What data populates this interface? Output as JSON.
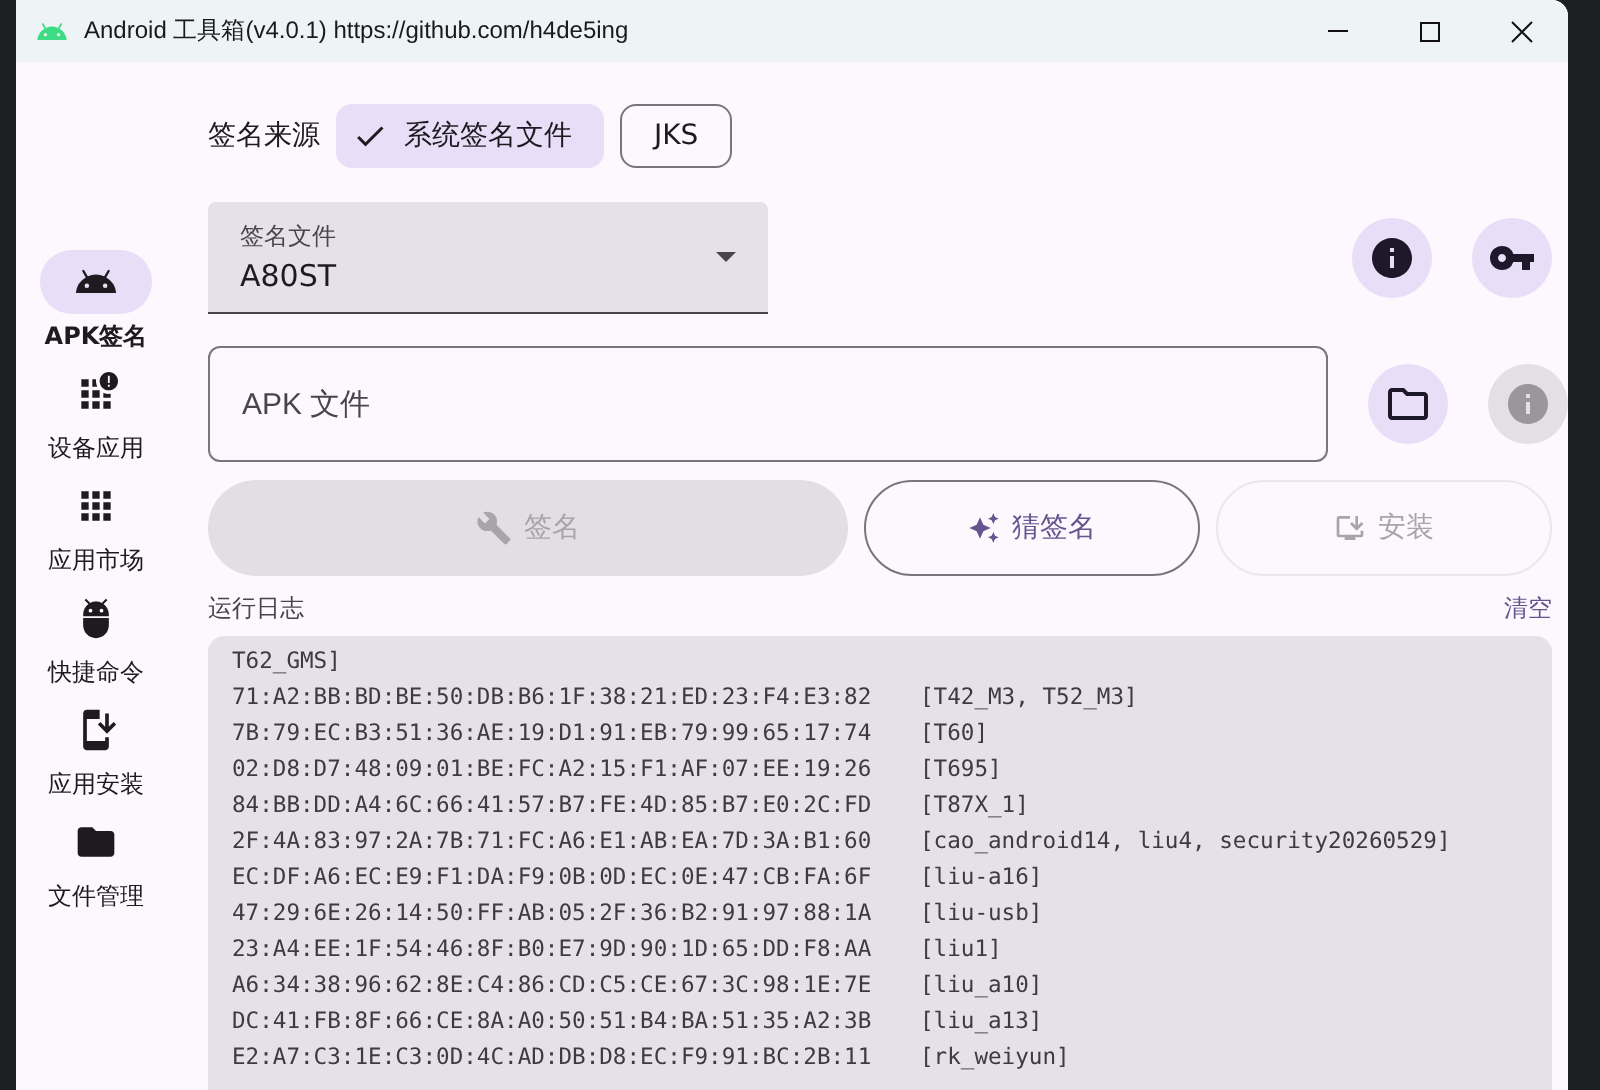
{
  "window": {
    "title": "Android 工具箱(v4.0.1) https://github.com/h4de5ing"
  },
  "nav": [
    {
      "label": "APK签名",
      "selected": true
    },
    {
      "label": "设备应用",
      "selected": false
    },
    {
      "label": "应用市场",
      "selected": false
    },
    {
      "label": "快捷命令",
      "selected": false
    },
    {
      "label": "应用安装",
      "selected": false
    },
    {
      "label": "文件管理",
      "selected": false
    }
  ],
  "signature_source": {
    "label": "签名来源",
    "options": [
      {
        "label": "系统签名文件",
        "selected": true
      },
      {
        "label": "JKS",
        "selected": false
      }
    ]
  },
  "signature_file": {
    "label": "签名文件",
    "value": "A80ST"
  },
  "apk_file": {
    "placeholder": "APK 文件"
  },
  "actions": [
    {
      "label": "签名",
      "disabled": true
    },
    {
      "label": "猜签名",
      "disabled": false
    },
    {
      "label": "安装",
      "disabled": true
    }
  ],
  "log": {
    "title": "运行日志",
    "clear": "清空",
    "lines": [
      {
        "kind": "continuation",
        "text": "T62_GMS]"
      },
      {
        "kind": "entry",
        "fingerprint": "71:A2:BB:BD:BE:50:DB:B6:1F:38:21:ED:23:F4:E3:82",
        "devices": "[T42_M3, T52_M3]"
      },
      {
        "kind": "entry",
        "fingerprint": "7B:79:EC:B3:51:36:AE:19:D1:91:EB:79:99:65:17:74",
        "devices": "[T60]"
      },
      {
        "kind": "entry",
        "fingerprint": "02:D8:D7:48:09:01:BE:FC:A2:15:F1:AF:07:EE:19:26",
        "devices": "[T695]"
      },
      {
        "kind": "entry",
        "fingerprint": "84:BB:DD:A4:6C:66:41:57:B7:FE:4D:85:B7:E0:2C:FD",
        "devices": "[T87X_1]"
      },
      {
        "kind": "entry",
        "fingerprint": "2F:4A:83:97:2A:7B:71:FC:A6:E1:AB:EA:7D:3A:B1:60",
        "devices": "[cao_android14, liu4, security20260529]"
      },
      {
        "kind": "entry",
        "fingerprint": "EC:DF:A6:EC:E9:F1:DA:F9:0B:0D:EC:0E:47:CB:FA:6F",
        "devices": "[liu-a16]"
      },
      {
        "kind": "entry",
        "fingerprint": "47:29:6E:26:14:50:FF:AB:05:2F:36:B2:91:97:88:1A",
        "devices": "[liu-usb]"
      },
      {
        "kind": "entry",
        "fingerprint": "23:A4:EE:1F:54:46:8F:B0:E7:9D:90:1D:65:DD:F8:AA",
        "devices": "[liu1]"
      },
      {
        "kind": "entry",
        "fingerprint": "A6:34:38:96:62:8E:C4:86:CD:C5:CE:67:3C:98:1E:7E",
        "devices": "[liu_a10]"
      },
      {
        "kind": "entry",
        "fingerprint": "DC:41:FB:8F:66:CE:8A:A0:50:51:B4:BA:51:35:A2:3B",
        "devices": "[liu_a13]"
      },
      {
        "kind": "entry",
        "fingerprint": "E2:A7:C3:1E:C3:0D:4C:AD:DB:D8:EC:F9:91:BC:2B:11",
        "devices": "[rk_weiyun]"
      }
    ]
  }
}
